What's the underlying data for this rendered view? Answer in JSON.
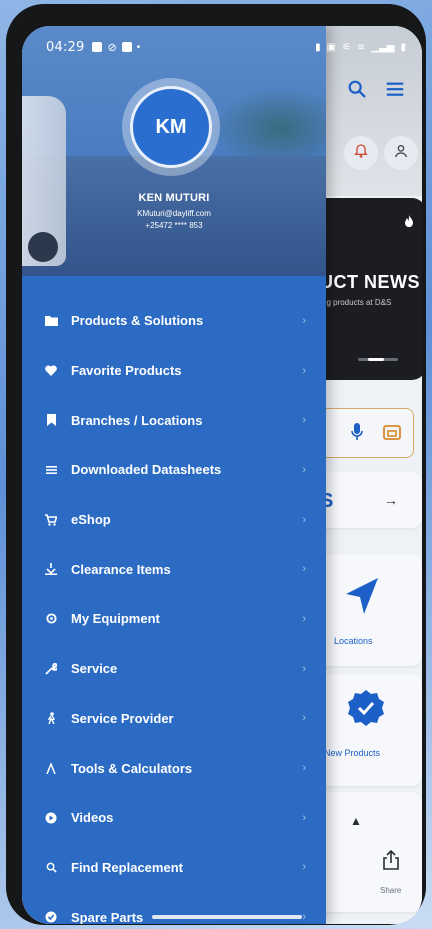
{
  "status_bar": {
    "time": "04:29"
  },
  "drawer": {
    "user": {
      "initials": "KM",
      "name": "KEN MUTURI",
      "email": "KMuturi@dayliff.com",
      "phone": "+25472 **** 853"
    },
    "menu_items": [
      {
        "label": "Products & Solutions",
        "icon": "folder-icon"
      },
      {
        "label": "Favorite Products",
        "icon": "heart-icon"
      },
      {
        "label": "Branches / Locations",
        "icon": "bookmark-icon"
      },
      {
        "label": "Downloaded Datasheets",
        "icon": "list-icon"
      },
      {
        "label": "eShop",
        "icon": "cart-icon"
      },
      {
        "label": "Clearance Items",
        "icon": "tag-icon"
      },
      {
        "label": "My Equipment",
        "icon": "gear-icon"
      },
      {
        "label": "Service",
        "icon": "wrench-icon"
      },
      {
        "label": "Service Provider",
        "icon": "person-icon"
      },
      {
        "label": "Tools & Calculators",
        "icon": "tools-icon"
      },
      {
        "label": "Videos",
        "icon": "play-icon"
      },
      {
        "label": "Find Replacement",
        "icon": "search-icon"
      },
      {
        "label": "Spare Parts",
        "icon": "check-circle-icon"
      }
    ]
  },
  "background_app": {
    "news_title": "UCT NEWS",
    "news_subtitle": "ng products at D&S",
    "search_label": "S",
    "tiles": {
      "locations": "Locations",
      "new_products": "New Products",
      "share": "Share"
    }
  },
  "colors": {
    "drawer": "#2b6bc4",
    "accent": "#1c5fc6"
  }
}
